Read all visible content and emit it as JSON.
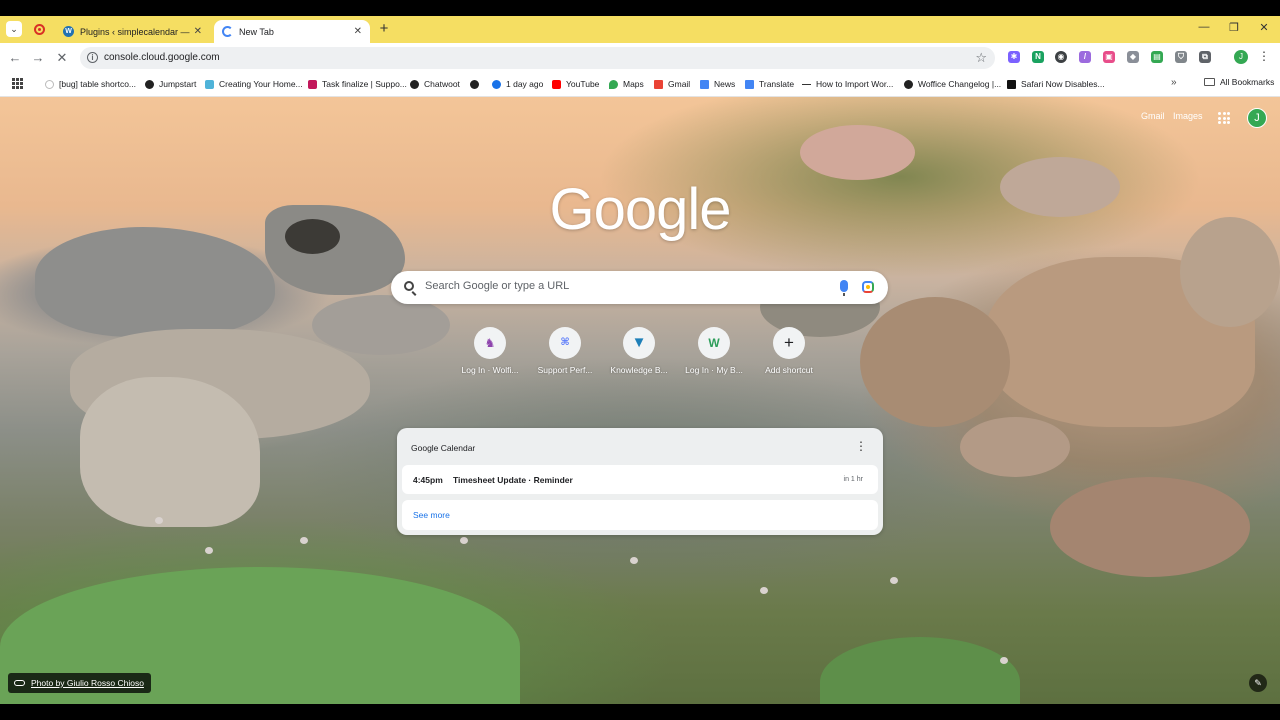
{
  "tabs": [
    {
      "title": "Plugins ‹ simplecalendar — Wo",
      "active": false
    },
    {
      "title": "New Tab",
      "active": true
    }
  ],
  "toolbar": {
    "url": "console.cloud.google.com"
  },
  "bookmarks": [
    "[bug] table shortco...",
    "Jumpstart",
    "Creating Your Home...",
    "Task finalize | Suppo...",
    "Chatwoot",
    "1 day ago",
    "YouTube",
    "Maps",
    "Gmail",
    "News",
    "Translate",
    "How to Import Wor...",
    "Woffice Changelog |...",
    "Safari Now Disables..."
  ],
  "all_bookmarks_label": "All Bookmarks",
  "ntp": {
    "gmail_link": "Gmail",
    "images_link": "Images",
    "avatar_initial": "J",
    "logo_text": "Google",
    "search_placeholder": "Search Google or type a URL",
    "shortcuts": [
      {
        "label": "Log In · Wolfi...",
        "icon": "wolf-icon"
      },
      {
        "label": "Support Perf...",
        "icon": "support-icon"
      },
      {
        "label": "Knowledge B...",
        "icon": "kb-icon"
      },
      {
        "label": "Log In · My B...",
        "icon": "w-logo-icon"
      },
      {
        "label": "Add shortcut",
        "icon": "plus-icon"
      }
    ],
    "calendar": {
      "title": "Google Calendar",
      "event_time": "4:45pm",
      "event_title": "Timesheet Update · Reminder",
      "event_relative": "in 1 hr",
      "see_more": "See more"
    },
    "photo_credit": "Photo by Giulio Rosso Chioso"
  },
  "colors": {
    "tabstrip": "#f5de62",
    "accent_blue": "#1a73e8",
    "avatar_green": "#34a853"
  }
}
